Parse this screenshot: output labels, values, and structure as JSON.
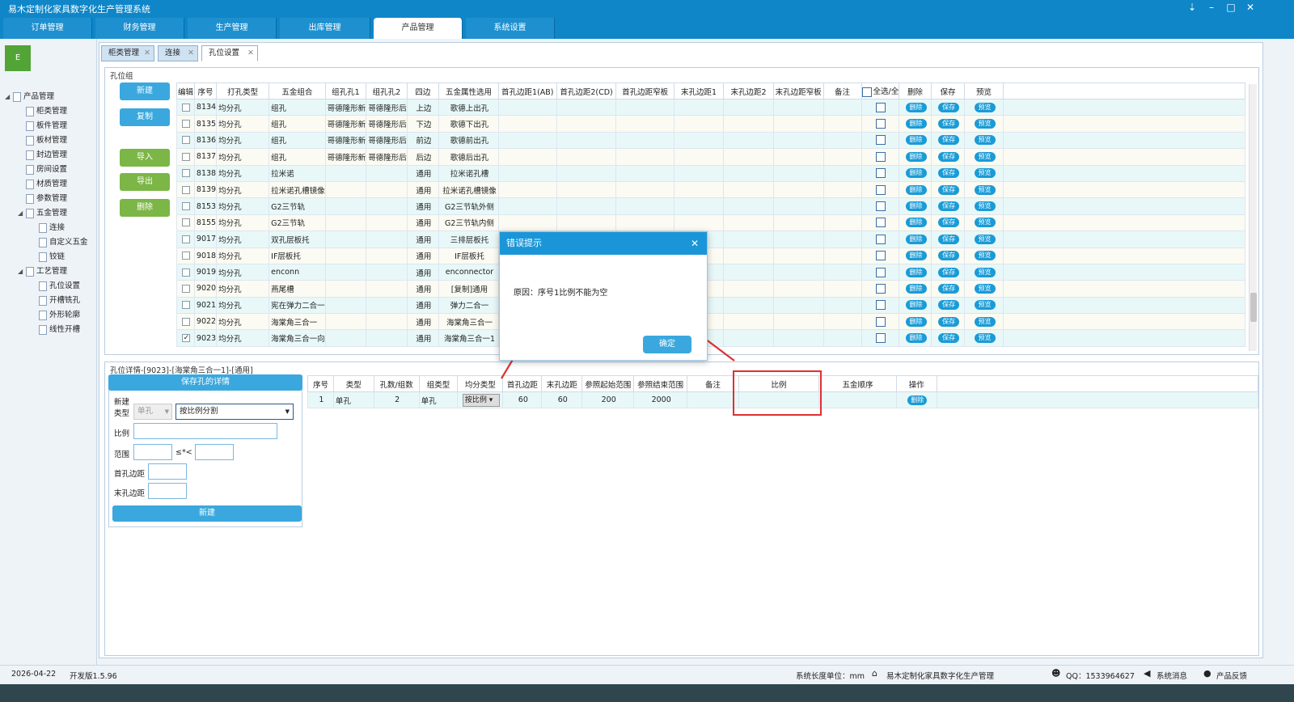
{
  "window": {
    "title": "易木定制化家具数字化生产管理系统",
    "controls": [
      "⇣",
      "–",
      "□",
      "✕"
    ]
  },
  "topnav": {
    "tabs": [
      "订单管理",
      "财务管理",
      "生产管理",
      "出库管理",
      "产品管理",
      "系统设置"
    ],
    "active": 4
  },
  "logo": {
    "text": "E"
  },
  "tree": [
    {
      "label": "产品管理",
      "level": 0,
      "toggle": "◢"
    },
    {
      "label": "柜类管理",
      "level": 1
    },
    {
      "label": "板件管理",
      "level": 1
    },
    {
      "label": "板材管理",
      "level": 1
    },
    {
      "label": "封边管理",
      "level": 1
    },
    {
      "label": "房间设置",
      "level": 1
    },
    {
      "label": "材质管理",
      "level": 1
    },
    {
      "label": "参数管理",
      "level": 1
    },
    {
      "label": "五金管理",
      "level": 1,
      "toggle": "◢"
    },
    {
      "label": "连接",
      "level": 2
    },
    {
      "label": "自定义五金",
      "level": 2
    },
    {
      "label": "铰链",
      "level": 2
    },
    {
      "label": "工艺管理",
      "level": 1,
      "toggle": "◢"
    },
    {
      "label": "孔位设置",
      "level": 2
    },
    {
      "label": "开槽铣孔",
      "level": 2
    },
    {
      "label": "外形轮廓",
      "level": 2
    },
    {
      "label": "线性开槽",
      "level": 2
    }
  ],
  "content_tabs": [
    {
      "label": "柜类管理"
    },
    {
      "label": "连接"
    },
    {
      "label": "孔位设置"
    }
  ],
  "group_section": {
    "legend": "孔位组",
    "buttons": [
      {
        "label": "新建",
        "color": "blue"
      },
      {
        "label": "复制",
        "color": "blue"
      },
      {
        "label": "导入",
        "color": "green"
      },
      {
        "label": "导出",
        "color": "green"
      },
      {
        "label": "删除",
        "color": "green"
      }
    ]
  },
  "grid": {
    "headers": [
      "编辑",
      "序号",
      "打孔类型",
      "五金组合",
      "组孔孔1",
      "组孔孔2",
      "四边",
      "五金属性选用",
      "首孔边距1(AB)",
      "首孔边距2(CD)",
      "首孔边距窄板",
      "末孔边距1",
      "末孔边距2",
      "末孔边距窄板",
      "备注",
      "全选/全",
      "删除",
      "保存",
      "预览"
    ],
    "actions": {
      "delete": "删除",
      "save": "保存",
      "preview": "预览"
    },
    "rows": [
      {
        "id": "8134",
        "type": "均分孔",
        "combo": "组孔",
        "h1": "哥德隆形新",
        "h2": "哥德隆形后",
        "side": "上边",
        "attr": "歌德上出孔",
        "checked": false
      },
      {
        "id": "8135",
        "type": "均分孔",
        "combo": "组孔",
        "h1": "哥德隆形新",
        "h2": "哥德隆形后",
        "side": "下边",
        "attr": "歌德下出孔",
        "checked": false
      },
      {
        "id": "8136",
        "type": "均分孔",
        "combo": "组孔",
        "h1": "哥德隆形新",
        "h2": "哥德隆形后",
        "side": "前边",
        "attr": "歌德前出孔",
        "checked": false
      },
      {
        "id": "8137",
        "type": "均分孔",
        "combo": "组孔",
        "h1": "哥德隆形新",
        "h2": "哥德隆形后",
        "side": "后边",
        "attr": "歌德后出孔",
        "checked": false
      },
      {
        "id": "8138",
        "type": "均分孔",
        "combo": "拉米诺",
        "h1": "",
        "h2": "",
        "side": "通用",
        "attr": "拉米诺孔槽",
        "checked": false
      },
      {
        "id": "8139",
        "type": "均分孔",
        "combo": "拉米诺孔槽镜像",
        "h1": "",
        "h2": "",
        "side": "通用",
        "attr": "拉米诺孔槽镜像",
        "checked": false
      },
      {
        "id": "8153",
        "type": "均分孔",
        "combo": "G2三节轨",
        "h1": "",
        "h2": "",
        "side": "通用",
        "attr": "G2三节轨外侧",
        "checked": false
      },
      {
        "id": "8155",
        "type": "均分孔",
        "combo": "G2三节轨",
        "h1": "",
        "h2": "",
        "side": "通用",
        "attr": "G2三节轨内侧",
        "checked": false
      },
      {
        "id": "9017",
        "type": "均分孔",
        "combo": "双孔层板托",
        "h1": "",
        "h2": "",
        "side": "通用",
        "attr": "三排层板托",
        "checked": false
      },
      {
        "id": "9018",
        "type": "均分孔",
        "combo": "IF层板托",
        "h1": "",
        "h2": "",
        "side": "通用",
        "attr": "IF层板托",
        "checked": false
      },
      {
        "id": "9019",
        "type": "均分孔",
        "combo": "enconn",
        "h1": "",
        "h2": "",
        "side": "通用",
        "attr": "enconnector",
        "checked": false
      },
      {
        "id": "9020",
        "type": "均分孔",
        "combo": "燕尾槽",
        "h1": "",
        "h2": "",
        "side": "通用",
        "attr": "[复制]通用",
        "checked": false
      },
      {
        "id": "9021",
        "type": "均分孔",
        "combo": "宪在弹力二合一",
        "h1": "",
        "h2": "",
        "side": "通用",
        "attr": "弹力二合一",
        "checked": false
      },
      {
        "id": "9022",
        "type": "均分孔",
        "combo": "海棠角三合一",
        "h1": "",
        "h2": "",
        "side": "通用",
        "attr": "海棠角三合一",
        "checked": false
      },
      {
        "id": "9023",
        "type": "均分孔",
        "combo": "海棠角三合一向",
        "h1": "",
        "h2": "",
        "side": "通用",
        "attr": "海棠角三合一1",
        "checked": true
      }
    ]
  },
  "detail": {
    "legend": "孔位详情-[9023]-[海棠角三合一1]-[通用]",
    "save_button": "保存孔的详情",
    "form": {
      "section": "新建",
      "type_label": "类型",
      "type_value": "单孔",
      "method_value": "按比例分割",
      "ratio_label": "比例",
      "range_label": "范围",
      "range_sep": "≤*<",
      "first_label": "首孔边距",
      "last_label": "末孔边距",
      "submit": "新建"
    },
    "headers": [
      "序号",
      "类型",
      "孔数/组数",
      "组类型",
      "均分类型",
      "首孔边距",
      "末孔边距",
      "参照起始范围",
      "参照结束范围",
      "备注",
      "比例",
      "五金顺序",
      "操作"
    ],
    "rows": [
      {
        "seq": "1",
        "type": "单孔",
        "count": "2",
        "group": "单孔",
        "split": "按比例",
        "first": "60",
        "last": "60",
        "start": "200",
        "end": "2000",
        "note": "",
        "ratio": "",
        "order": "",
        "op": "删除"
      }
    ]
  },
  "dialog": {
    "title": "错误提示",
    "close": "✕",
    "message": "原因：序号1比例不能为空",
    "ok": "确定"
  },
  "annotation": {
    "color": "#e03030"
  },
  "status": {
    "date": "2026-04-22",
    "version": "开发版1.5.96",
    "unit": "系统长度单位：mm",
    "app": "易木定制化家具数字化生产管理",
    "qq": "QQ：1533964627",
    "msg": "系统消息",
    "feedback": "产品反馈"
  }
}
